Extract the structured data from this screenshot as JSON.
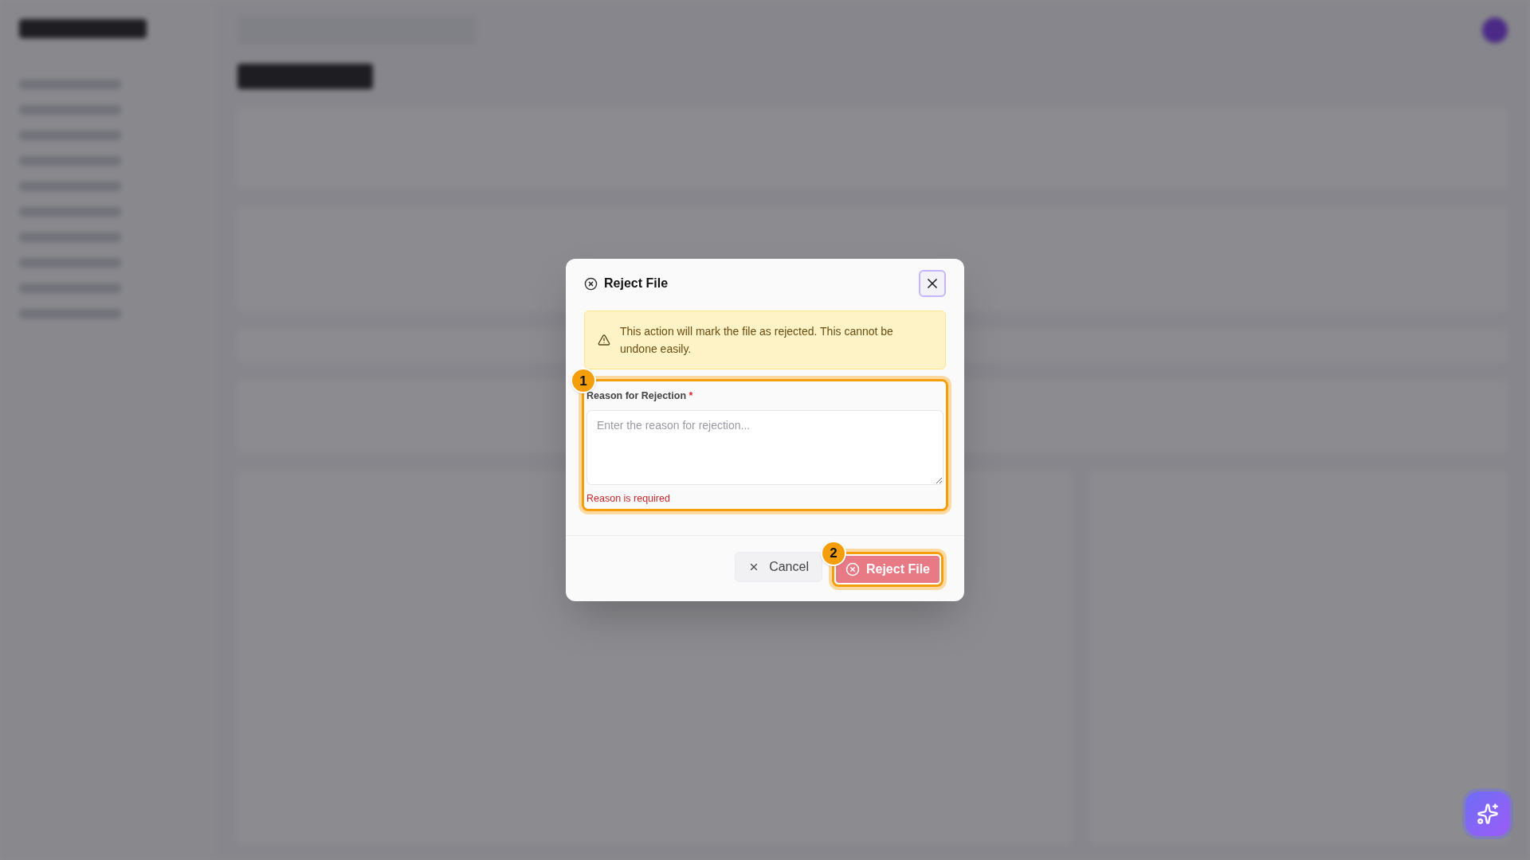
{
  "dialog": {
    "title": "Reject File",
    "warning": "This action will mark the file as rejected. This cannot be undone easily.",
    "field": {
      "label": "Reason for Rejection",
      "required_mark": "*",
      "placeholder": "Enter the reason for rejection...",
      "error": "Reason is required",
      "step": "1"
    },
    "buttons": [
      {
        "label": "Cancel",
        "kind": "secondary"
      },
      {
        "label": "Reject File",
        "kind": "danger",
        "step": "2"
      }
    ]
  }
}
